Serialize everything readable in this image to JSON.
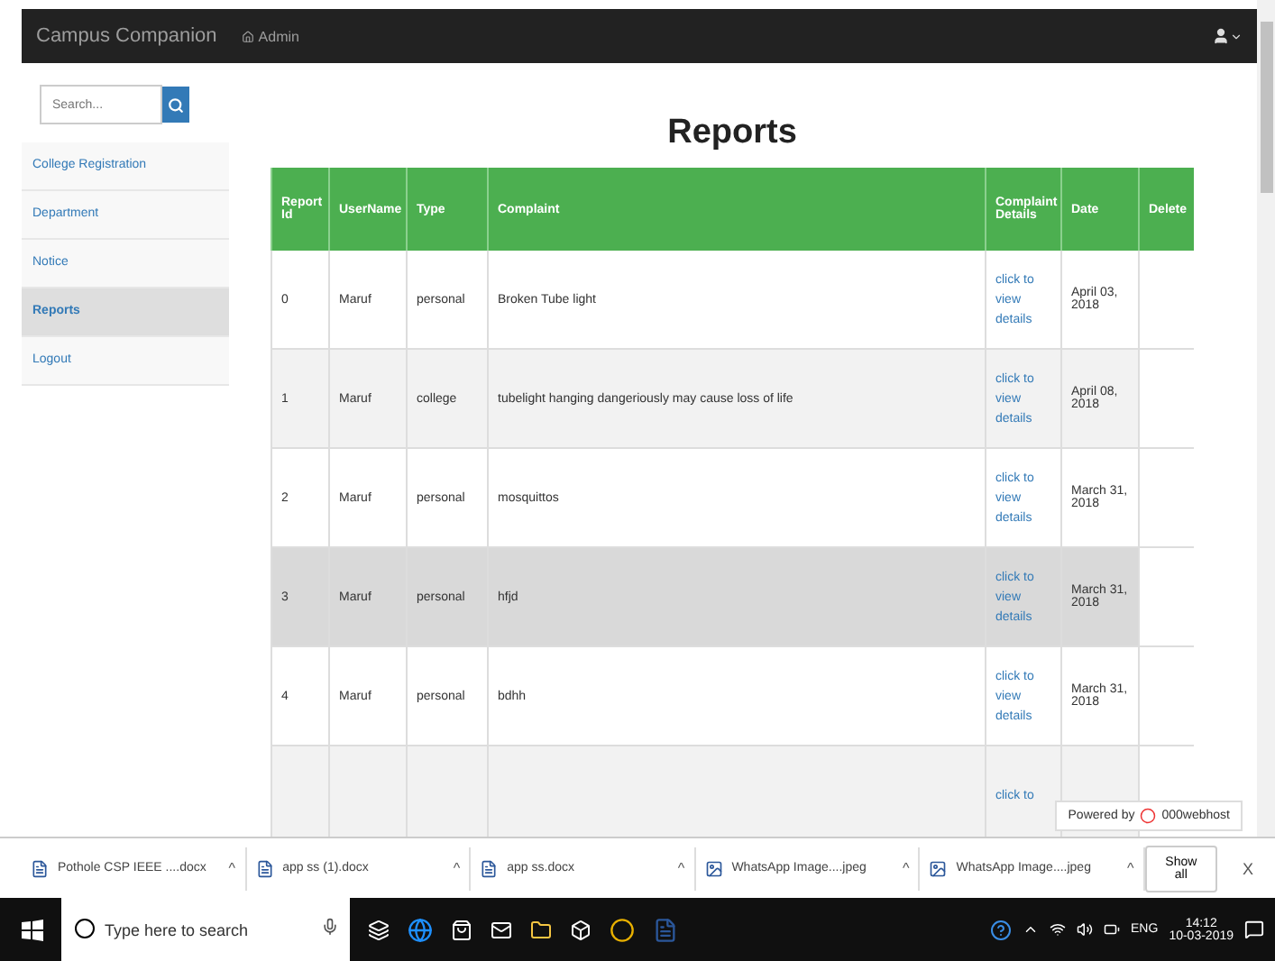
{
  "navbar": {
    "brand": "Campus Companion",
    "link": "Admin"
  },
  "sidebar": {
    "search": {
      "placeholder": "Search..."
    },
    "items": [
      {
        "label": "College Registration",
        "selected": false
      },
      {
        "label": "Department",
        "selected": false
      },
      {
        "label": "Notice",
        "selected": false
      },
      {
        "label": "Reports",
        "selected": true
      },
      {
        "label": "Logout",
        "selected": false
      }
    ]
  },
  "page_title": "Reports",
  "table": {
    "columns": [
      "Report Id",
      "UserName",
      "Type",
      "Complaint",
      "Complaint Details",
      "Date",
      "Delete"
    ],
    "rows": [
      {
        "id": "0",
        "username": "Maruf",
        "type": "personal",
        "complaint": "Broken Tube light",
        "details": "click to view details",
        "date": "April 03, 2018",
        "highlighted": false
      },
      {
        "id": "1",
        "username": "Maruf",
        "type": "college",
        "complaint": "tubelight hanging dangeriously may cause loss of life",
        "details": "click to view details",
        "date": "April 08, 2018",
        "highlighted": false
      },
      {
        "id": "2",
        "username": "Maruf",
        "type": "personal",
        "complaint": "mosquittos",
        "details": "click to view details",
        "date": "March 31, 2018",
        "highlighted": false
      },
      {
        "id": "3",
        "username": "Maruf",
        "type": "personal",
        "complaint": "hfjd",
        "details": "click to view details",
        "date": "March 31, 2018",
        "highlighted": true
      },
      {
        "id": "4",
        "username": "Maruf",
        "type": "personal",
        "complaint": "bdhh",
        "details": "click to view details",
        "date": "March 31, 2018",
        "highlighted": false
      },
      {
        "details": "click to",
        "highlighted": false
      }
    ]
  },
  "badge": {
    "prefix": "Powered by",
    "name": "000webhost"
  },
  "downloads": {
    "items": [
      {
        "name": "Pothole CSP IEEE ....docx",
        "kind": "doc",
        "caret": "^"
      },
      {
        "name": "app ss (1).docx",
        "kind": "doc",
        "caret": "^"
      },
      {
        "name": "app ss.docx",
        "kind": "doc",
        "caret": "^"
      },
      {
        "name": "WhatsApp Image....jpeg",
        "kind": "image",
        "caret": "^"
      },
      {
        "name": "WhatsApp Image....jpeg",
        "kind": "image",
        "caret": "^"
      }
    ],
    "show_all": "Show all",
    "close": "X"
  },
  "taskbar": {
    "search": {
      "placeholder": "Type here to search"
    },
    "language": "ENG",
    "time": "14:12",
    "date": "10-03-2019"
  }
}
